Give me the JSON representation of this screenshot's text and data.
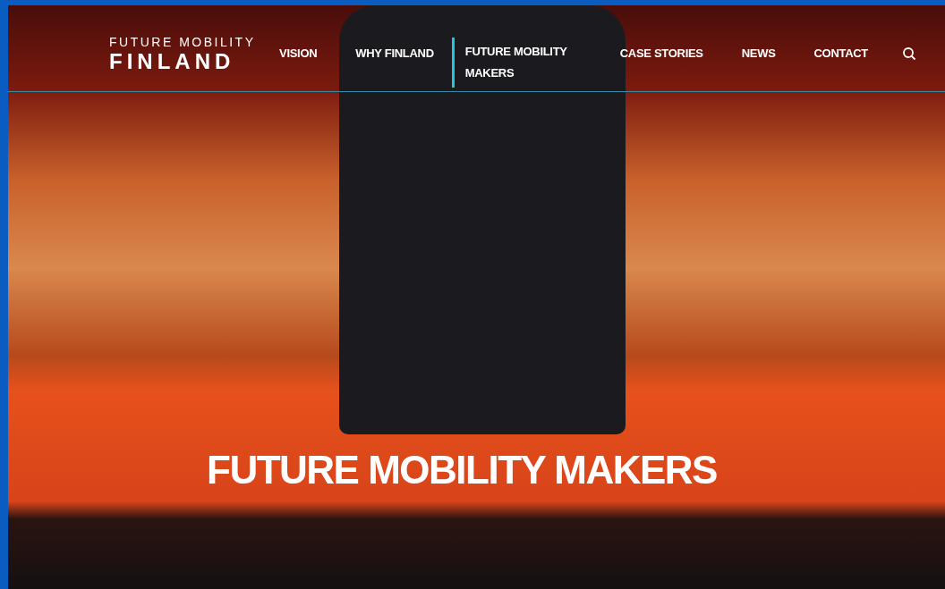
{
  "logo": {
    "line_1": "FUTURE MOBILITY",
    "line_2": "FINLAND"
  },
  "nav": [
    {
      "label": "VISION",
      "selected": false
    },
    {
      "label": "WHY FINLAND",
      "selected": false
    },
    {
      "label": "FUTURE MOBILITY MAKERS",
      "selected": true
    },
    {
      "label": "CASE STORIES",
      "selected": false
    },
    {
      "label": "NEWS",
      "selected": false
    },
    {
      "label": "CONTACT",
      "selected": false
    }
  ],
  "hero": {
    "title": "FUTURE MOBILITY MAKERS"
  }
}
